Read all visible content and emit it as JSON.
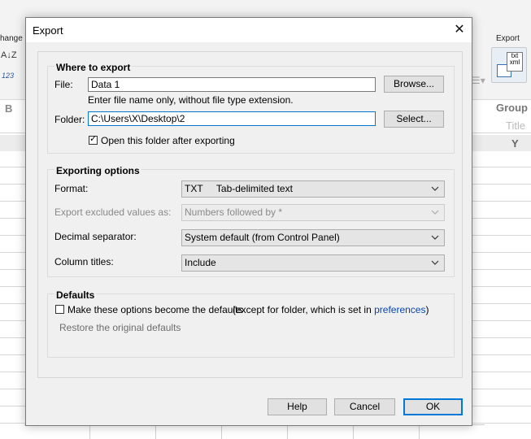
{
  "background": {
    "left_ribbon_label": "hange",
    "sort_icon": "A↓Z",
    "number_icon": "123",
    "export_label": "Export",
    "export_icon_text": "txt\nxml",
    "column_b": "B",
    "group_header": "Group",
    "title_header": "Title",
    "y_header": "Y"
  },
  "dialog": {
    "title": "Export",
    "where": {
      "heading": "Where to export",
      "file_label": "File:",
      "file_value": "Data 1",
      "browse_button": "Browse...",
      "file_hint": "Enter file name only, without file type extension.",
      "folder_label": "Folder:",
      "folder_value": "C:\\Users\\X\\Desktop\\2",
      "select_button": "Select...",
      "open_folder_checked": true,
      "open_folder_label": "Open this folder after exporting"
    },
    "options": {
      "heading": "Exporting options",
      "format_label": "Format:",
      "format_value": "TXT     Tab-delimited text",
      "excluded_label": "Export excluded values as:",
      "excluded_value": "Numbers followed by *",
      "decimal_label": "Decimal separator:",
      "decimal_value": "System default (from Control Panel)",
      "column_titles_label": "Column titles:",
      "column_titles_value": "Include"
    },
    "defaults": {
      "heading": "Defaults",
      "make_default_checked": false,
      "make_default_label": "Make these options become the defaults",
      "except_text": "(except for folder, which is set in",
      "preferences_link": "preferences",
      "close_paren": ")",
      "restore_text": "Restore the original defaults"
    },
    "buttons": {
      "help": "Help",
      "cancel": "Cancel",
      "ok": "OK"
    }
  },
  "colors": {
    "accent": "#0078d7",
    "link": "#0645ad",
    "dialog_bg": "#f0f0f0"
  }
}
